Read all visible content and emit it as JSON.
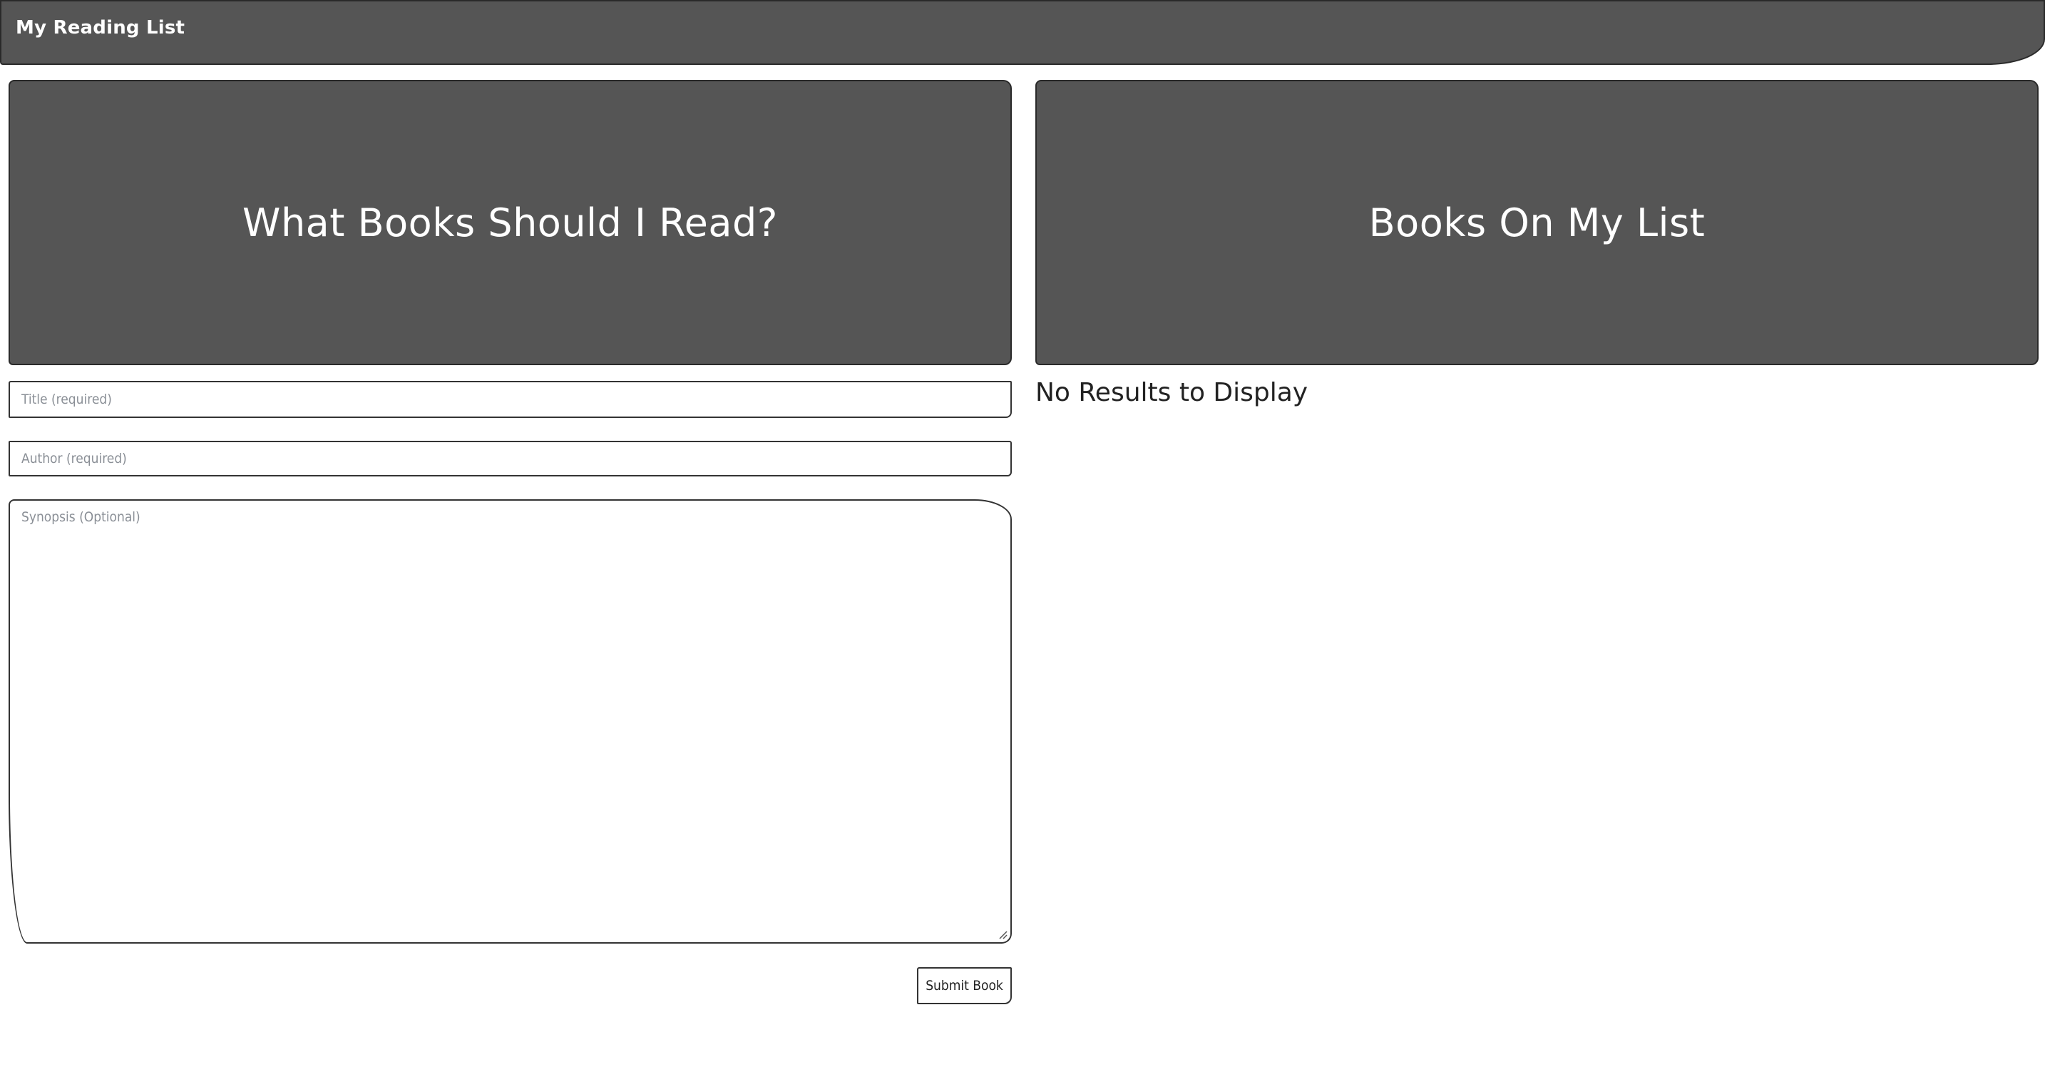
{
  "navbar": {
    "brand": "My Reading List"
  },
  "search_panel": {
    "heading": "What Books Should I Read?",
    "form": {
      "title_placeholder": "Title (required)",
      "author_placeholder": "Author (required)",
      "synopsis_placeholder": "Synopsis (Optional)",
      "submit_label": "Submit Book"
    }
  },
  "list_panel": {
    "heading": "Books On My List",
    "empty_message": "No Results to Display"
  },
  "colors": {
    "panel_background": "#555555",
    "panel_text": "#ffffff",
    "border": "#333333",
    "page_background": "#ffffff"
  }
}
